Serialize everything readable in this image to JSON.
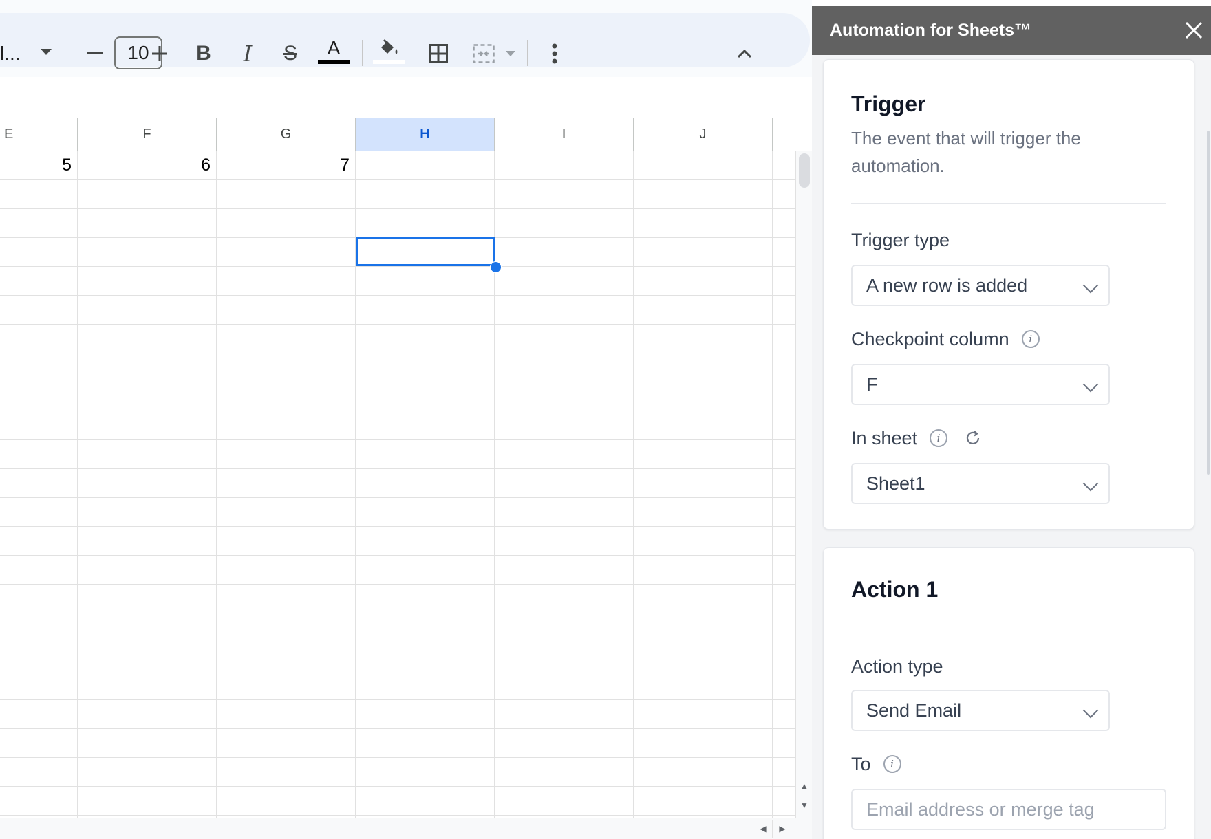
{
  "toolbar": {
    "font_name": "l...",
    "font_dropdown_icon": "caret-down-icon",
    "decrease_icon": "minus-icon",
    "font_size": "10",
    "increase_icon": "plus-icon",
    "bold_glyph": "B",
    "italic_glyph": "I",
    "strike_glyph": "S",
    "text_color_glyph": "A",
    "text_color_bar": "#000000",
    "fill_icon": "paint-bucket-icon",
    "borders_icon": "borders-icon",
    "merge_icon": "merge-cells-icon",
    "more_icon": "more-vertical-icon",
    "collapse_icon": "chevron-up-icon"
  },
  "sheet": {
    "columns": [
      "E",
      "F",
      "G",
      "H",
      "I",
      "J"
    ],
    "selected_column": "H",
    "row1_values": [
      "5",
      "6",
      "7",
      "",
      "",
      ""
    ],
    "colors": {
      "header_selected_bg": "#d3e3fd",
      "selection": "#1a73e8",
      "grid": "#e1e1e1"
    }
  },
  "panel": {
    "title": "Automation for Sheets™",
    "close_icon": "close-icon",
    "trigger": {
      "heading": "Trigger",
      "description": "The event that will trigger the automation.",
      "trigger_type_label": "Trigger type",
      "trigger_type_value": "A new row is added",
      "checkpoint_label": "Checkpoint column",
      "checkpoint_value": "F",
      "sheet_label": "In sheet",
      "sheet_value": "Sheet1"
    },
    "action": {
      "heading": "Action 1",
      "action_type_label": "Action type",
      "action_type_value": "Send Email",
      "to_label": "To",
      "to_placeholder": "Email address or merge tag"
    }
  }
}
